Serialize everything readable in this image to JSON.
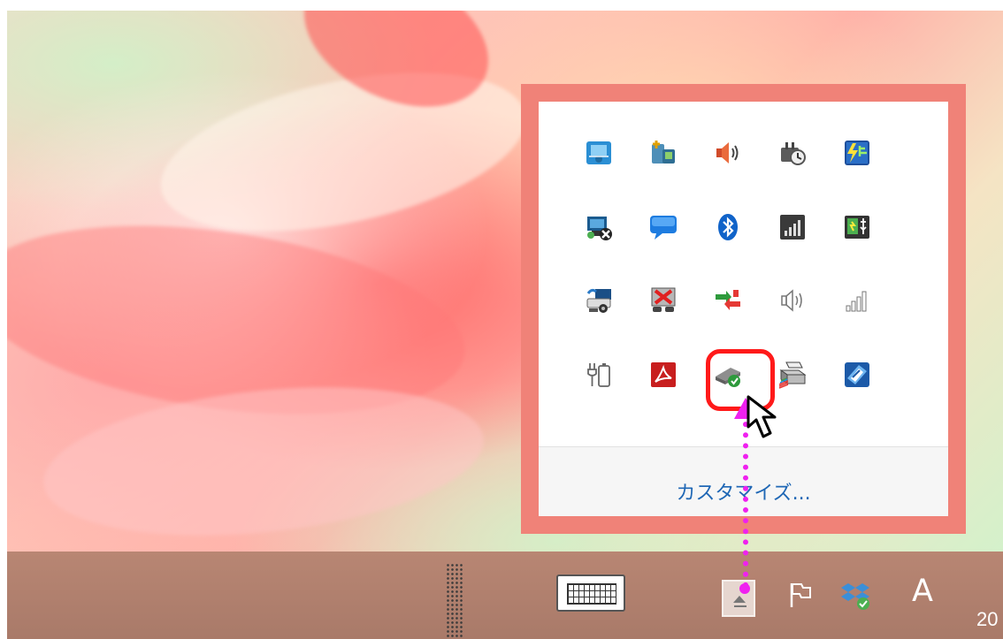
{
  "overflow_panel": {
    "icons": [
      {
        "name": "network-sharing-icon",
        "row": 0,
        "col": 0
      },
      {
        "name": "computer-setup-icon",
        "row": 0,
        "col": 1
      },
      {
        "name": "speaker-volume-icon",
        "row": 0,
        "col": 2
      },
      {
        "name": "power-clock-icon",
        "row": 0,
        "col": 3
      },
      {
        "name": "power-manager-icon",
        "row": 0,
        "col": 4
      },
      {
        "name": "network-disconnected-icon",
        "row": 1,
        "col": 0
      },
      {
        "name": "message-bubble-icon",
        "row": 1,
        "col": 1
      },
      {
        "name": "bluetooth-icon",
        "row": 1,
        "col": 2
      },
      {
        "name": "signal-strength-dark-icon",
        "row": 1,
        "col": 3
      },
      {
        "name": "usb-device-icon",
        "row": 1,
        "col": 4
      },
      {
        "name": "network-adapter-icon",
        "row": 2,
        "col": 0
      },
      {
        "name": "display-error-icon",
        "row": 2,
        "col": 1
      },
      {
        "name": "sync-arrows-icon",
        "row": 2,
        "col": 2
      },
      {
        "name": "speaker-outline-icon",
        "row": 2,
        "col": 3
      },
      {
        "name": "signal-bars-icon",
        "row": 2,
        "col": 4
      },
      {
        "name": "battery-plug-icon",
        "row": 3,
        "col": 0
      },
      {
        "name": "acrobat-reader-icon",
        "row": 3,
        "col": 1
      },
      {
        "name": "safely-remove-hardware-icon",
        "row": 3,
        "col": 2
      },
      {
        "name": "printer-icon",
        "row": 3,
        "col": 3
      },
      {
        "name": "graphics-settings-icon",
        "row": 3,
        "col": 4
      }
    ],
    "customize_label": "カスタマイズ..."
  },
  "taskbar": {
    "keyboard_icon": "touch-keyboard-icon",
    "show_hidden_icon": "show-hidden-icons-chevron-icon",
    "tray_icons": [
      "action-center-flag-icon",
      "dropbox-sync-icon"
    ],
    "ime_indicator": "A",
    "clock_text": "20"
  },
  "colors": {
    "panel_frame": "#f08278",
    "highlight_ring": "#ff1a1a",
    "annotation_arrow": "#ef21ef",
    "link": "#1f67b5",
    "taskbar": "#b08070"
  }
}
